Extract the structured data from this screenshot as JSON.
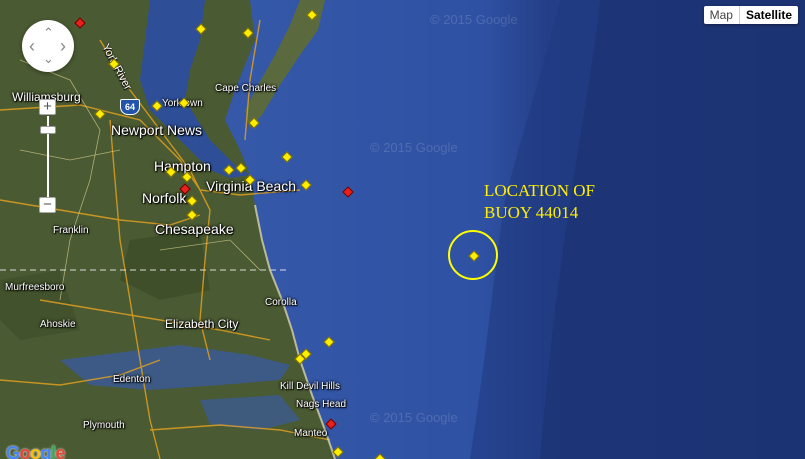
{
  "map_type_control": {
    "map_label": "Map",
    "satellite_label": "Satellite",
    "selected": "Satellite"
  },
  "zoom_control": {
    "zoom_in": "+",
    "zoom_out": "−"
  },
  "pan_control": {
    "up": "⌃",
    "down": "⌄",
    "left": "‹",
    "right": "›"
  },
  "annotation": {
    "line1": "LOCATION OF",
    "line2": "BUOY 44014"
  },
  "places": {
    "york_river": "York River",
    "williamsburg": "Williamsburg",
    "yorktown": "Yorktown",
    "newport_news": "Newport News",
    "hampton": "Hampton",
    "norfolk": "Norfolk",
    "virginia_beach": "Virginia Beach",
    "chesapeake": "Chesapeake",
    "franklin": "Franklin",
    "cape_charles": "Cape Charles",
    "murfreesboro": "Murfreesboro",
    "ahoskie": "Ahoskie",
    "elizabeth_city": "Elizabeth City",
    "corolla": "Corolla",
    "edenton": "Edenton",
    "kill_devil_hills": "Kill Devil Hills",
    "nags_head": "Nags Head",
    "plymouth": "Plymouth",
    "manteo": "Manteo"
  },
  "highway_shield": "64",
  "branding": {
    "logo": "Google"
  },
  "watermarks": [
    "© 2015 Google",
    "© 2015 Google",
    "© 2015 Google"
  ],
  "colors": {
    "station_marker": "#ffee00",
    "alert_marker": "#e8221b",
    "annotation": "#ffee00",
    "ocean": "#2f4f9a",
    "land": "#4a5a32"
  }
}
